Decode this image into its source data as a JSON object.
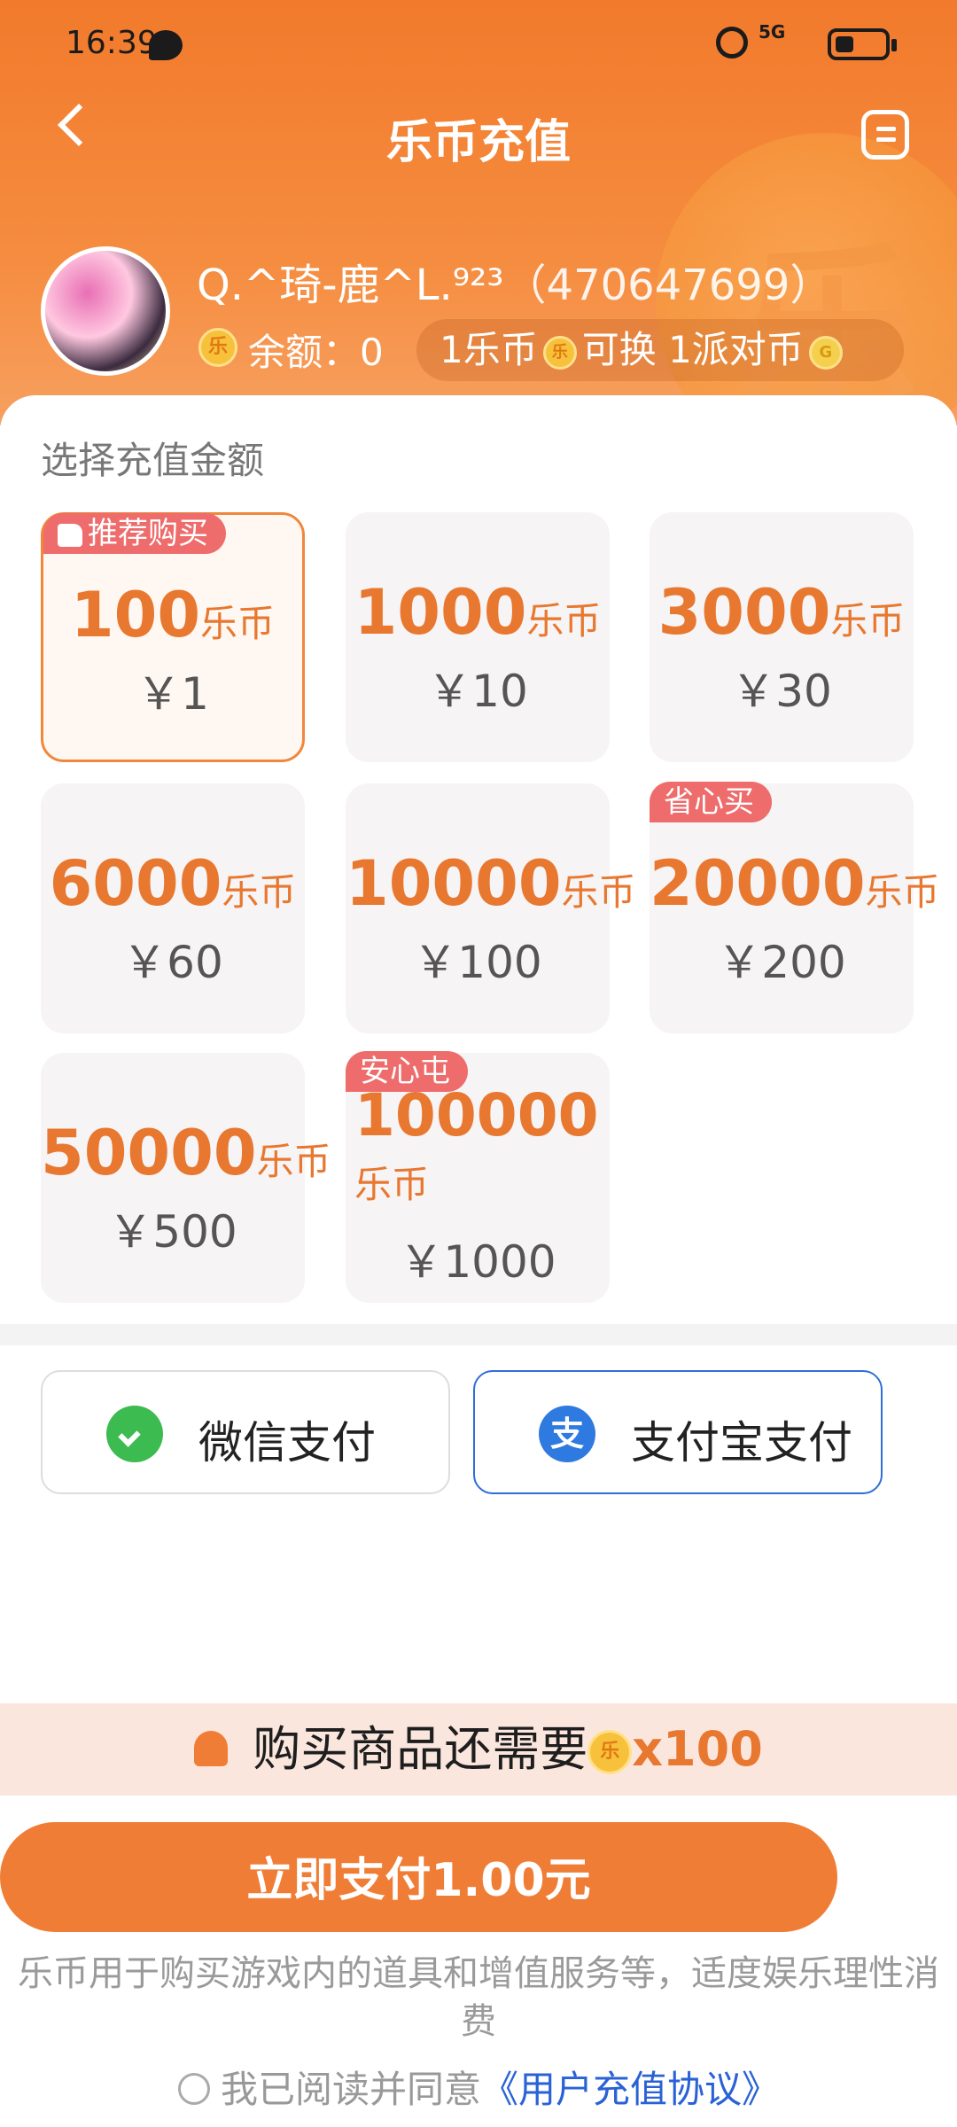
{
  "status_bar": {
    "time": "16:39",
    "signal": "5G"
  },
  "header": {
    "title": "乐币充值"
  },
  "user": {
    "name": "Q.^琦-鹿^L.⁹²³",
    "uid": "（470647699）",
    "balance_label": "余额：",
    "balance_value": "0",
    "exchange_left": "1乐币",
    "exchange_mid": "可换 1派对币"
  },
  "coin_glyph": "乐",
  "amount_section": {
    "title": "选择充值金额"
  },
  "unit": "乐币",
  "options": [
    {
      "amount": "100",
      "price": "￥1",
      "tag": "推荐购买"
    },
    {
      "amount": "1000",
      "price": "￥10"
    },
    {
      "amount": "3000",
      "price": "￥30"
    },
    {
      "amount": "6000",
      "price": "￥60"
    },
    {
      "amount": "10000",
      "price": "￥100"
    },
    {
      "amount": "20000",
      "price": "￥200",
      "tag": "省心买"
    },
    {
      "amount": "50000",
      "price": "￥500"
    },
    {
      "amount": "100000",
      "price": "￥1000",
      "tag": "安心屯"
    }
  ],
  "payment": {
    "wechat_label": "微信支付",
    "alipay_label": "支付宝支付",
    "alipay_glyph": "支",
    "selected": "alipay"
  },
  "notice": {
    "text": "购买商品还需要",
    "count": "x100"
  },
  "pay_button": {
    "label": "立即支付1.00元"
  },
  "disclaimer": "乐币用于购买游戏内的道具和增值服务等，适度娱乐理性消费",
  "agreement": {
    "prefix": "我已阅读并同意",
    "link": "《用户充值协议》"
  },
  "colors": {
    "accent": "#f07d35",
    "header_top": "#f27a2c",
    "tag": "#ee6c6c",
    "alipay_border": "#2e6ed8",
    "wechat": "#3cbb50"
  }
}
